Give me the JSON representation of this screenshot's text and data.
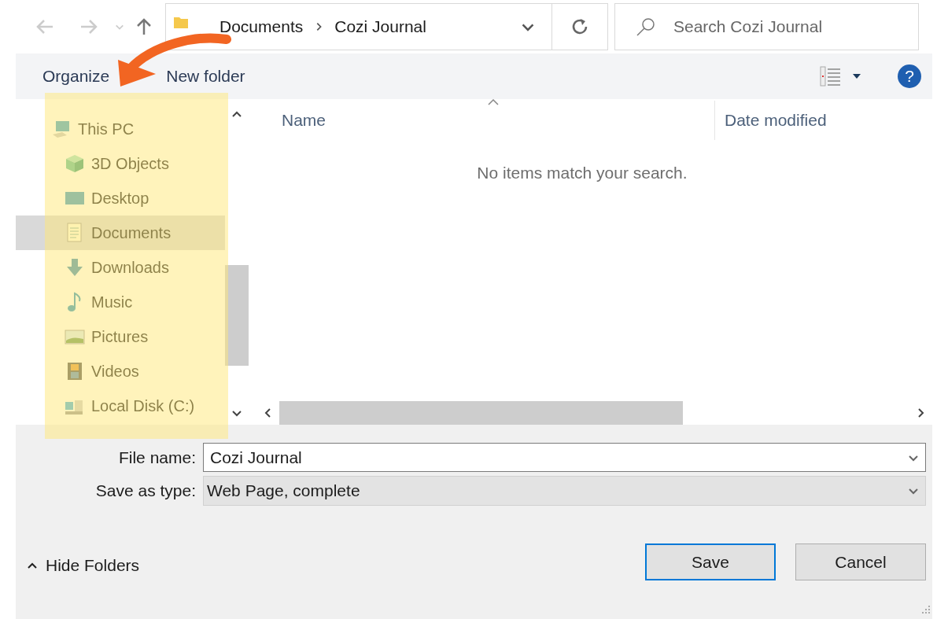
{
  "address": {
    "crumbs": [
      "Documents",
      "Cozi Journal"
    ]
  },
  "search": {
    "placeholder": "Search Cozi Journal"
  },
  "toolbar": {
    "buttons": [
      "Organize",
      "New folder"
    ],
    "help": "?"
  },
  "sidebar": {
    "items": [
      {
        "label": "This PC",
        "kind": "pc",
        "selected": false,
        "children": [
          {
            "label": "3D Objects",
            "kind": "cube",
            "selected": false
          },
          {
            "label": "Desktop",
            "kind": "desktop",
            "selected": false
          },
          {
            "label": "Documents",
            "kind": "document",
            "selected": true
          },
          {
            "label": "Downloads",
            "kind": "download",
            "selected": false
          },
          {
            "label": "Music",
            "kind": "music",
            "selected": false
          },
          {
            "label": "Pictures",
            "kind": "pictures",
            "selected": false
          },
          {
            "label": "Videos",
            "kind": "videos",
            "selected": false
          },
          {
            "label": "Local Disk (C:)",
            "kind": "disk",
            "selected": false
          }
        ]
      }
    ]
  },
  "table": {
    "columns": [
      {
        "label": "Name",
        "sorted": true
      },
      {
        "label": "Date modified",
        "sorted": false
      }
    ],
    "empty_message": "No items match your search."
  },
  "form": {
    "fields": [
      {
        "label": "File name:",
        "value": "Cozi Journal",
        "kind": "editable"
      },
      {
        "label": "Save as type:",
        "value": "Web Page, complete",
        "kind": "select"
      }
    ]
  },
  "hide_folders": "Hide Folders",
  "buttons": [
    {
      "label": "Save",
      "default": true
    },
    {
      "label": "Cancel",
      "default": false
    }
  ]
}
